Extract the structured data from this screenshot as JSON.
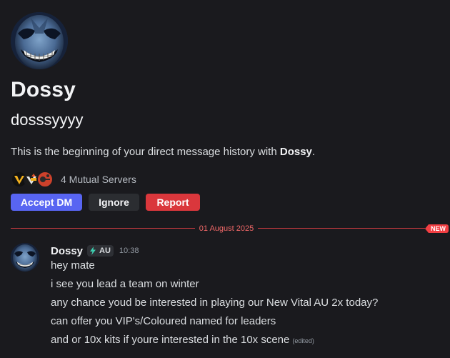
{
  "profile": {
    "display_name": "Dossy",
    "username": "dosssyyyy",
    "intro_prefix": "This is the beginning of your direct message history with ",
    "intro_name": "Dossy",
    "intro_suffix": "."
  },
  "mutuals": {
    "label": "4 Mutual Servers",
    "icons": [
      "server-v-icon",
      "server-vital-icon",
      "server-rust-icon"
    ]
  },
  "actions": {
    "accept_label": "Accept DM",
    "ignore_label": "Ignore",
    "report_label": "Report"
  },
  "divider": {
    "date": "01 August 2025",
    "badge": "NEW"
  },
  "message": {
    "author": "Dossy",
    "tag": "AU",
    "timestamp": "10:38",
    "lines": [
      "hey mate",
      "i see you lead a team on winter",
      "any chance youd be interested in playing our New Vital AU 2x today?",
      "can offer you VIP's/Coloured named for leaders",
      "and or 10x kits if youre interested in the 10x scene"
    ],
    "edited_label": "(edited)"
  },
  "colors": {
    "background": "#1a1a1e",
    "accept": "#5865f2",
    "ignore": "#2b2d31",
    "report": "#da373c",
    "new_line": "#f23f43"
  }
}
